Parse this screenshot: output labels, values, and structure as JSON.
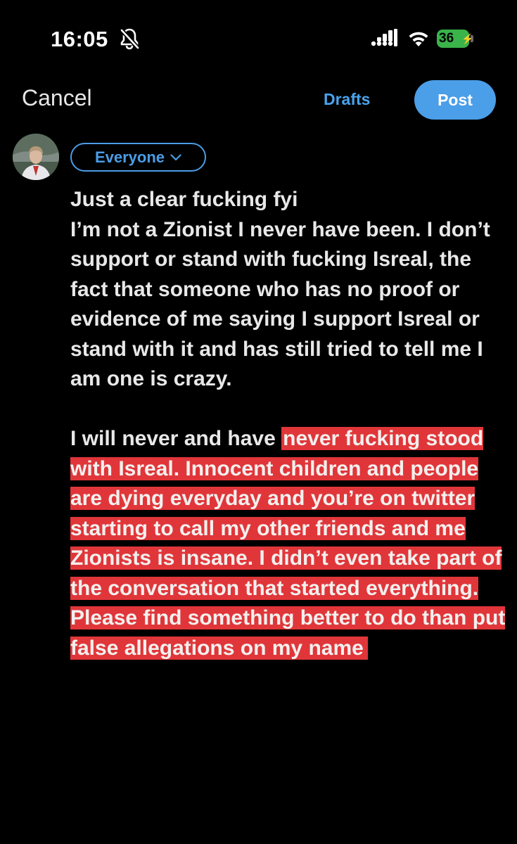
{
  "status_bar": {
    "time": "16:05",
    "battery": "36"
  },
  "header": {
    "cancel_label": "Cancel",
    "drafts_label": "Drafts",
    "post_label": "Post"
  },
  "composer": {
    "audience_label": "Everyone",
    "paragraph1": "Just a clear fucking fyi\nI’m not a Zionist I never have been. I don’t support or stand with fucking Isreal, the fact that someone who has no proof or evidence of me saying I support Isreal or stand with it and has still tried to tell me I am one is crazy.",
    "paragraph2_plain": "I will never and have ",
    "paragraph2_selected": "never fucking stood with Isreal. Innocent children and people are dying everyday and you’re on twitter starting to call my other friends and me Zionists is insane. I didn’t even take part of the conversation that started everything. Please find something better to do than put false allegations on my name"
  },
  "colors": {
    "background": "#000000",
    "accent": "#4b9ee8",
    "selection": "#e0363a",
    "battery": "#3ab34a"
  },
  "icons": [
    "bell-slash-icon",
    "cellular-signal-icon",
    "wifi-icon",
    "battery-icon",
    "chevron-down-icon"
  ]
}
